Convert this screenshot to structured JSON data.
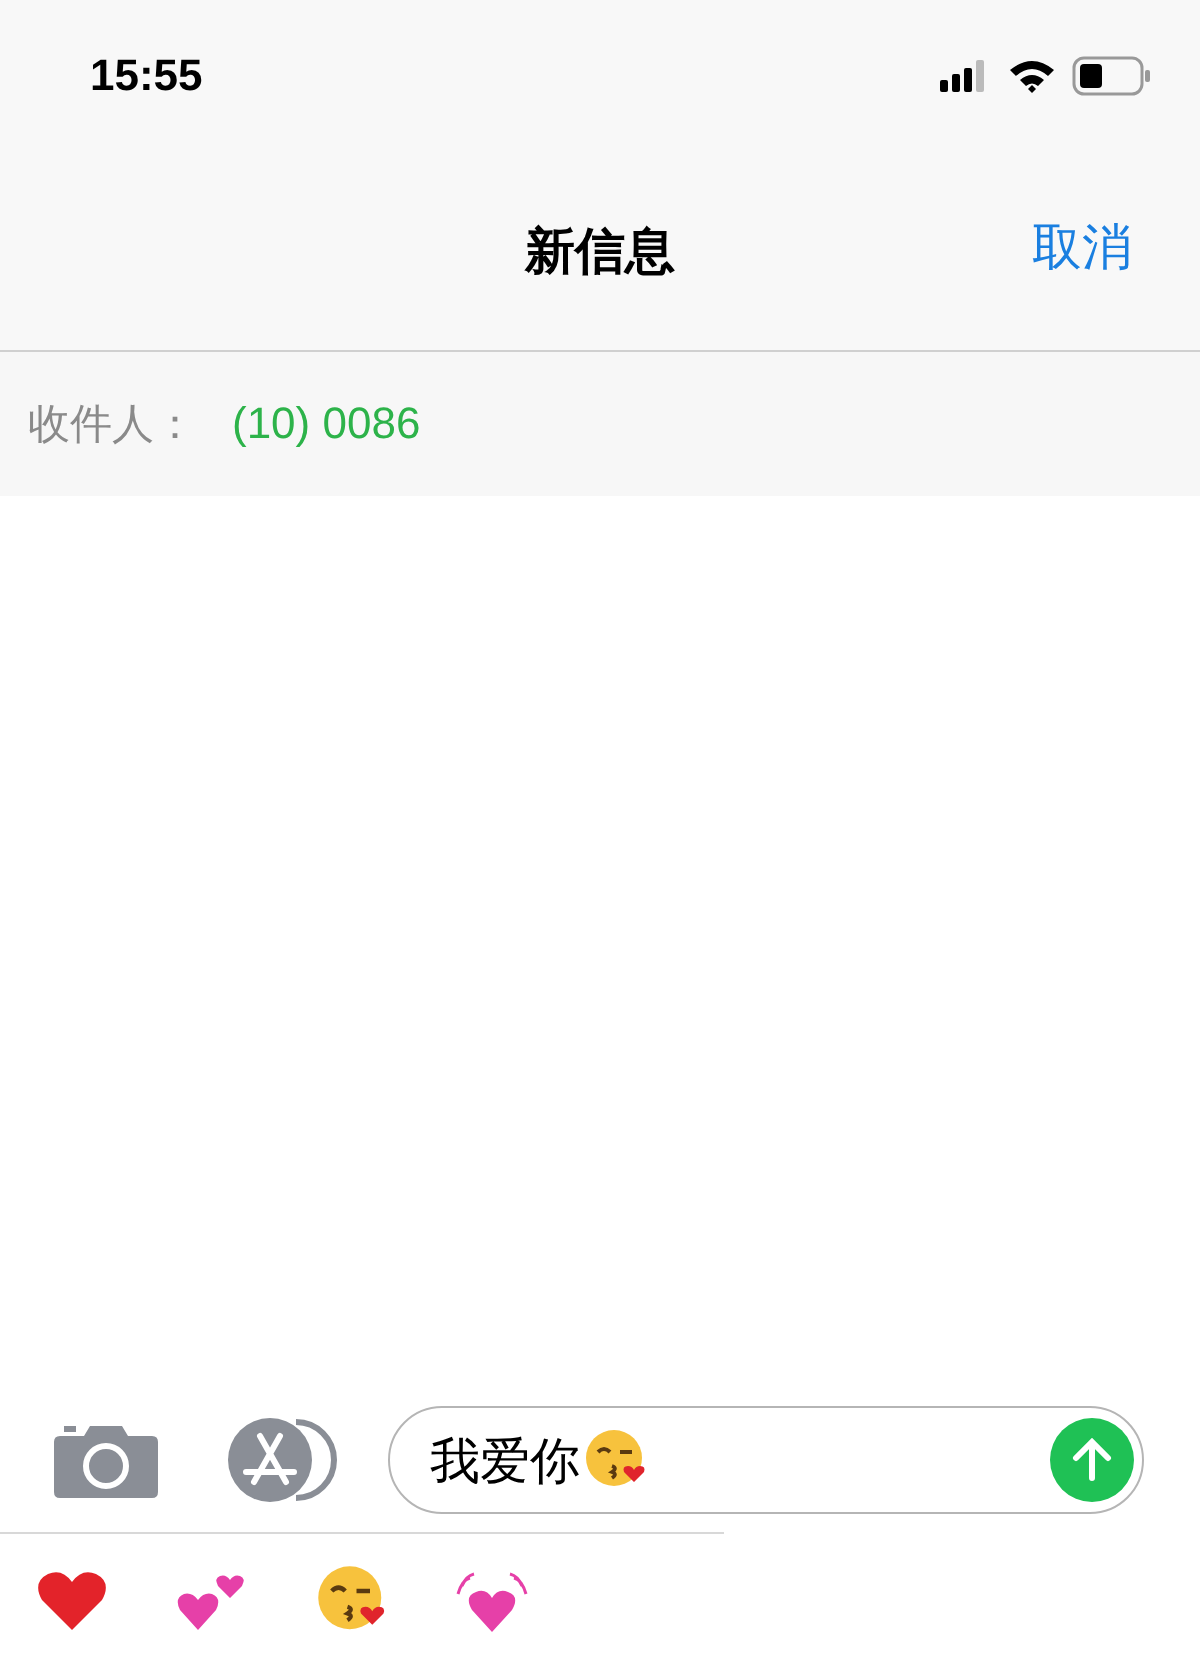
{
  "status_bar": {
    "time": "15:55"
  },
  "nav": {
    "title": "新信息",
    "cancel": "取消"
  },
  "recipient": {
    "label": "收件人：",
    "value": "(10) 0086"
  },
  "composer": {
    "value": "我爱你"
  }
}
